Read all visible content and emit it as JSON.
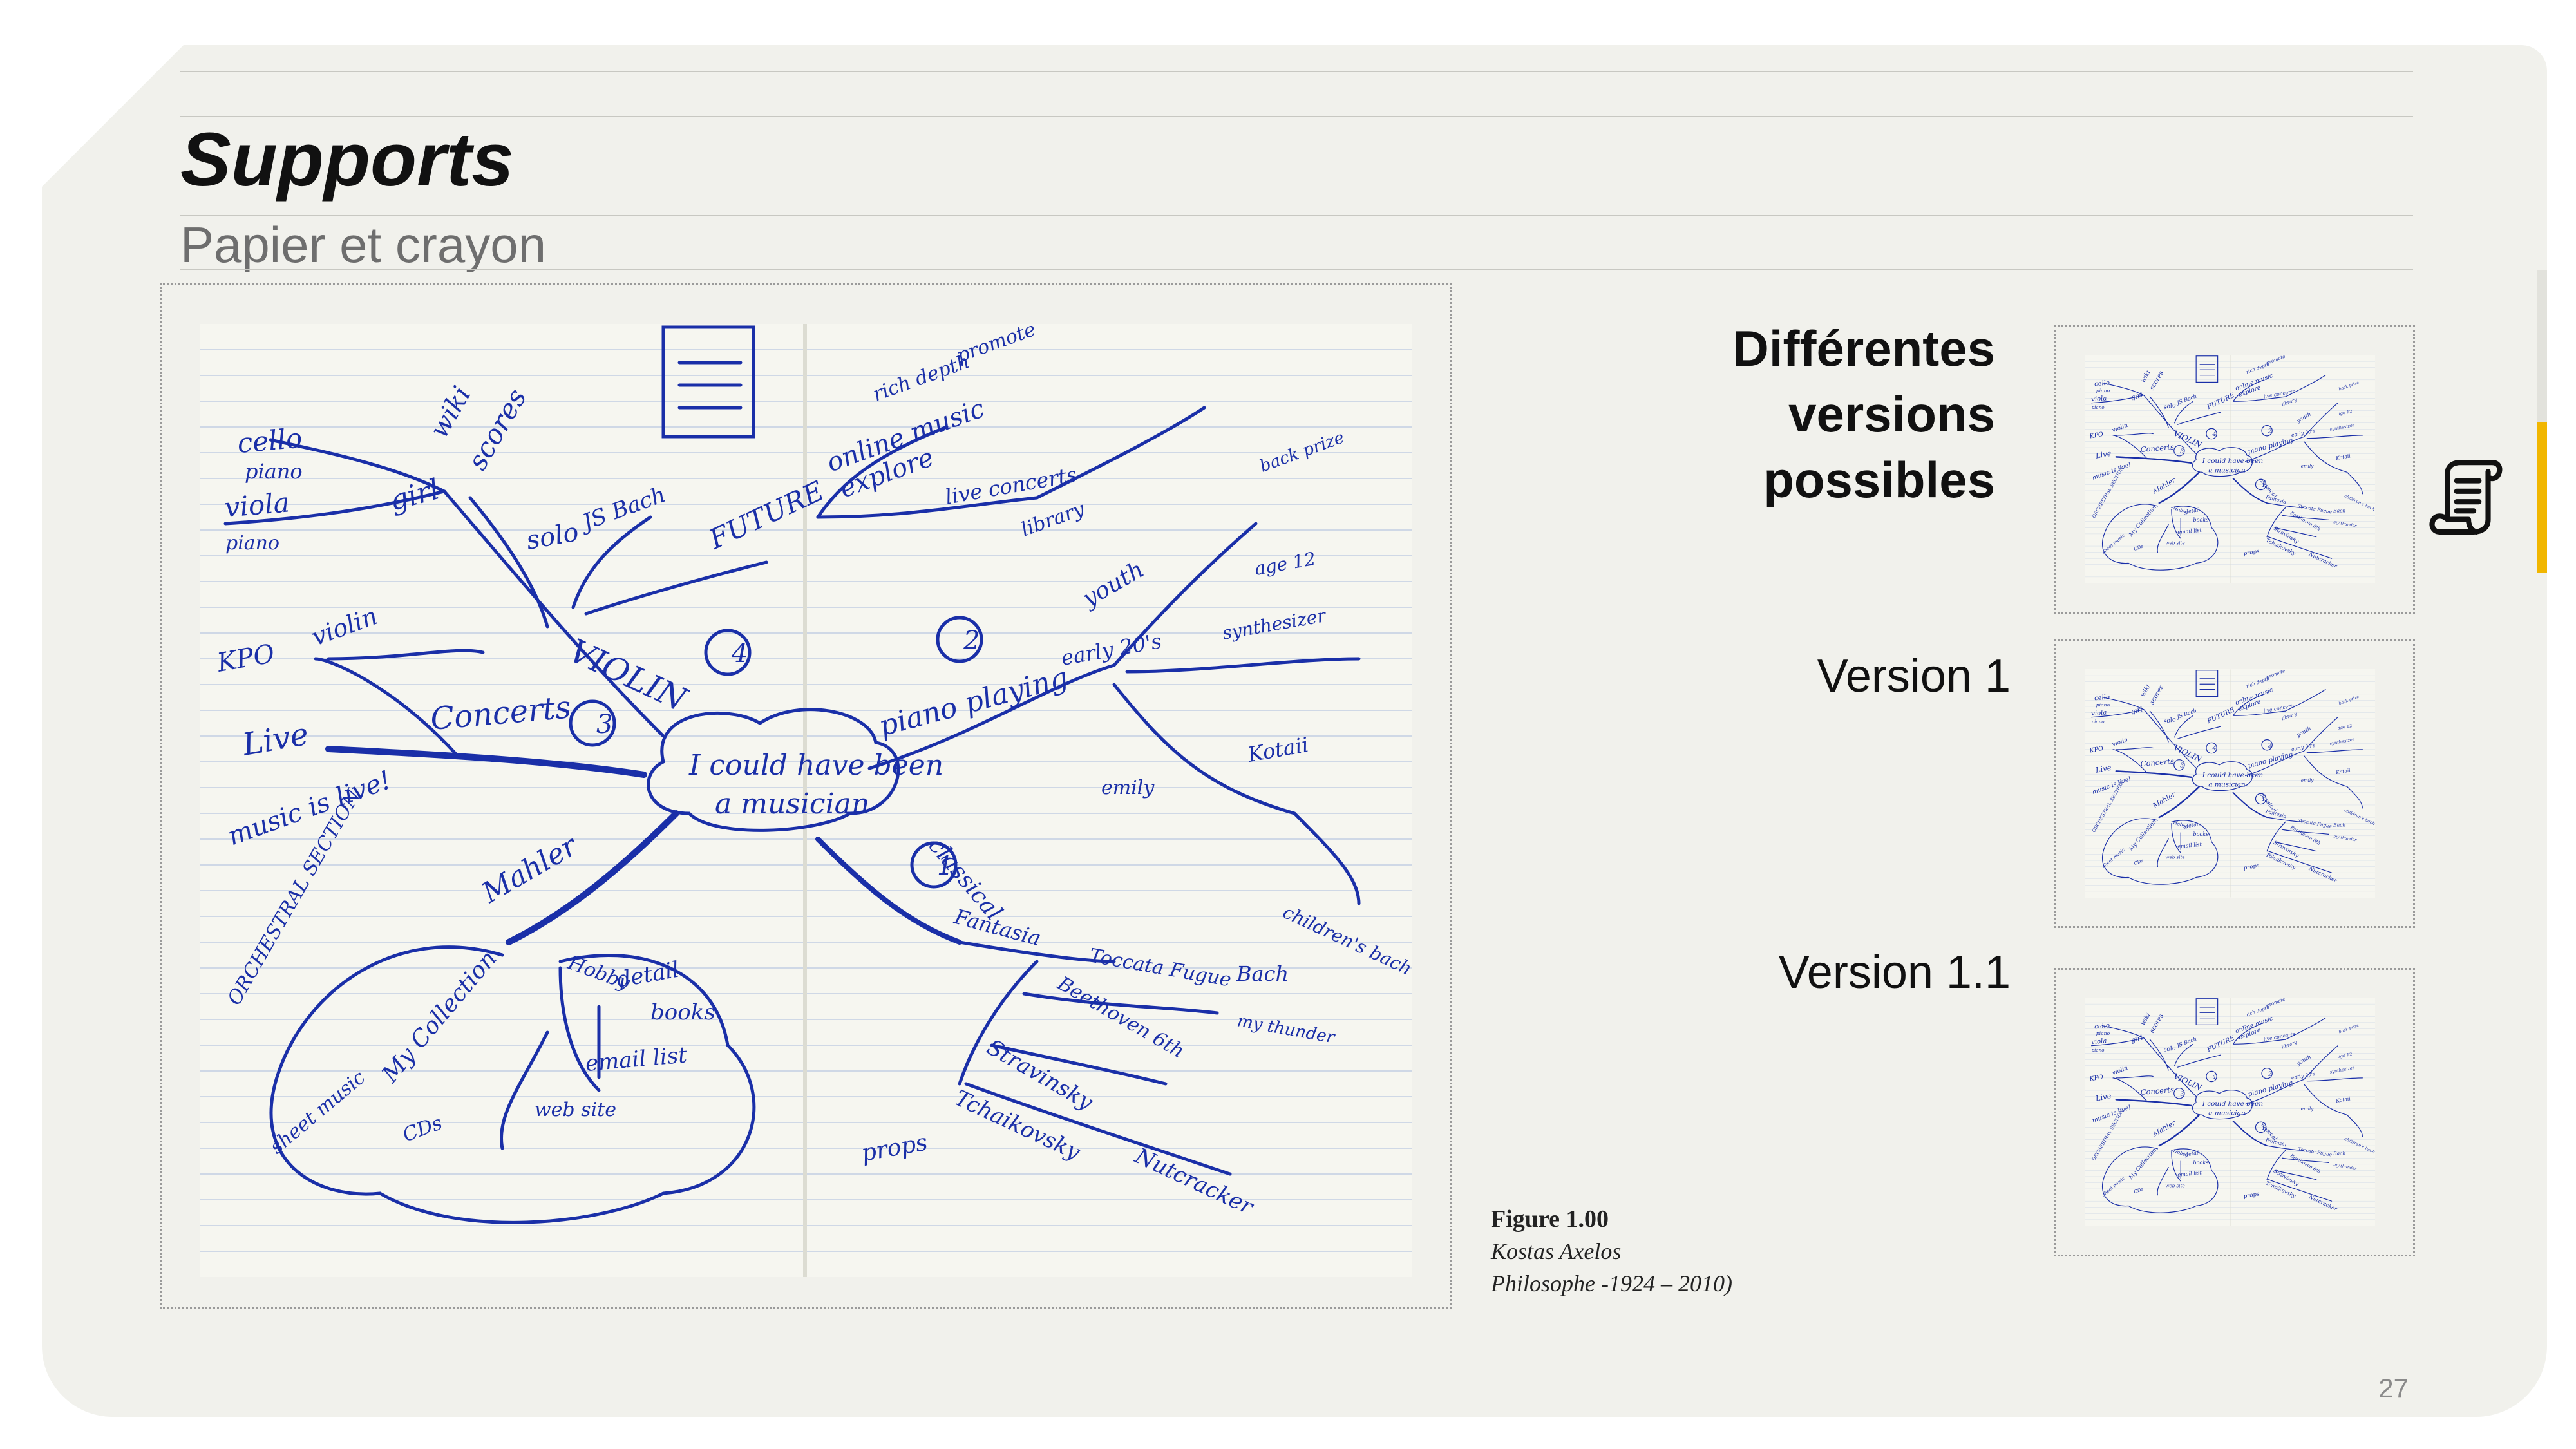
{
  "slide": {
    "title": "Supports",
    "subtitle": "Papier et crayon",
    "page_number": "27"
  },
  "caption": {
    "figure": "Figure 1.00",
    "author": "Kostas Axelos",
    "description": "Philosophe -1924 – 2010)"
  },
  "versions": {
    "heading_lines": [
      "Différentes",
      "versions",
      "possibles"
    ],
    "version_1": "Version 1",
    "version_1_1": "Version 1.1"
  },
  "mindmap": {
    "center_lines": [
      "I could have been",
      "a musician"
    ],
    "words": [
      "cello",
      "piano",
      "viola",
      "piano",
      "wiki",
      "girl",
      "scores",
      "solo",
      "JS Bach",
      "FUTURE",
      "KPO",
      "violin",
      "Live",
      "Concerts",
      "music is live!",
      "VIOLIN",
      "Mahler",
      "ORCHESTRAL SECTION",
      "My Collection",
      "sheet music",
      "CDs",
      "detail",
      "books",
      "email list",
      "web site",
      "Hobby",
      "piano playing",
      "youth",
      "early 20's",
      "classical",
      "Fantasia",
      "Toccata Fugue",
      "Bach",
      "Beethoven 6th",
      "Stravinsky",
      "Tchaikovsky",
      "Nutcracker",
      "props",
      "online music",
      "explore",
      "live concerts",
      "library",
      "synthesizer",
      "Kotaii",
      "emily",
      "children's bach",
      "rich depth",
      "promote",
      "back prize",
      "age 12",
      "my thunder",
      "1",
      "2",
      "3",
      "4"
    ]
  },
  "colors": {
    "accent": "#f1b600",
    "ink": "#1a2fa8",
    "paper": "#f6f6f0",
    "slide_bg": "#f1f1ec"
  },
  "icons": {
    "document": "scroll-document-icon"
  }
}
